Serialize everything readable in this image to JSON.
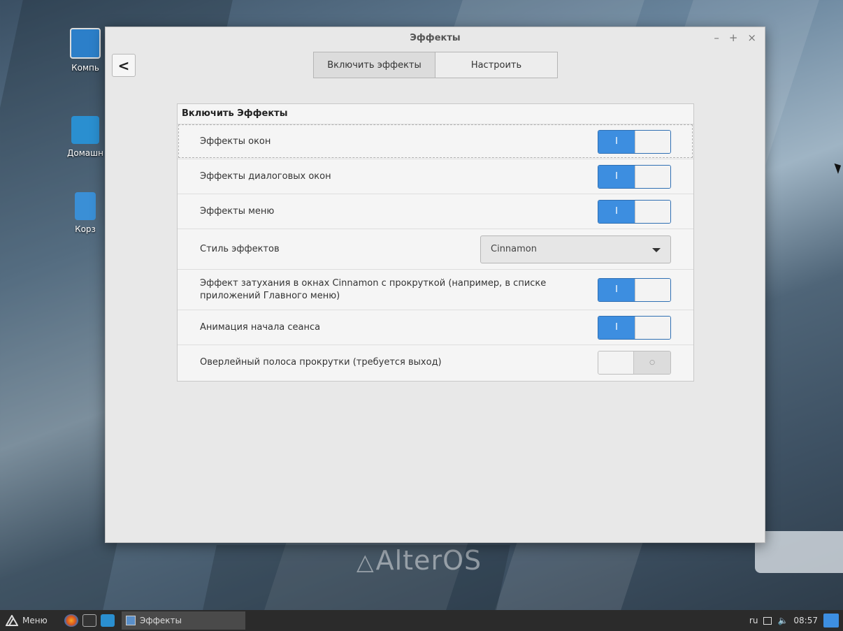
{
  "desktop": {
    "icons": [
      {
        "label": "Компь"
      },
      {
        "label": "Домашн"
      },
      {
        "label": "Корз"
      }
    ],
    "brand": "AlterOS"
  },
  "window": {
    "title": "Эффекты",
    "controls": {
      "minimize": "–",
      "maximize": "+",
      "close": "×"
    },
    "back_label": "<",
    "tabs": [
      {
        "label": "Включить эффекты",
        "active": true
      },
      {
        "label": "Настроить",
        "active": false
      }
    ],
    "section_title": "Включить Эффекты",
    "settings": [
      {
        "label": "Эффекты окон",
        "type": "toggle",
        "on": true
      },
      {
        "label": "Эффекты диалоговых окон",
        "type": "toggle",
        "on": true
      },
      {
        "label": "Эффекты меню",
        "type": "toggle",
        "on": true
      },
      {
        "label": "Стиль эффектов",
        "type": "select",
        "value": "Cinnamon"
      },
      {
        "label": "Эффект затухания в окнах Cinnamon с прокруткой (например, в списке приложений Главного меню)",
        "type": "toggle",
        "on": true
      },
      {
        "label": "Анимация начала сеанса",
        "type": "toggle",
        "on": true
      },
      {
        "label": "Оверлейный полоса прокрутки (требуется выход)",
        "type": "toggle",
        "on": false
      }
    ],
    "toggle_on_glyph": "I",
    "toggle_off_glyph": "○"
  },
  "taskbar": {
    "menu_label": "Меню",
    "task_label": "Эффекты",
    "keyboard_layout": "ru",
    "clock": "08:57",
    "accent": "#3d8ee0"
  }
}
